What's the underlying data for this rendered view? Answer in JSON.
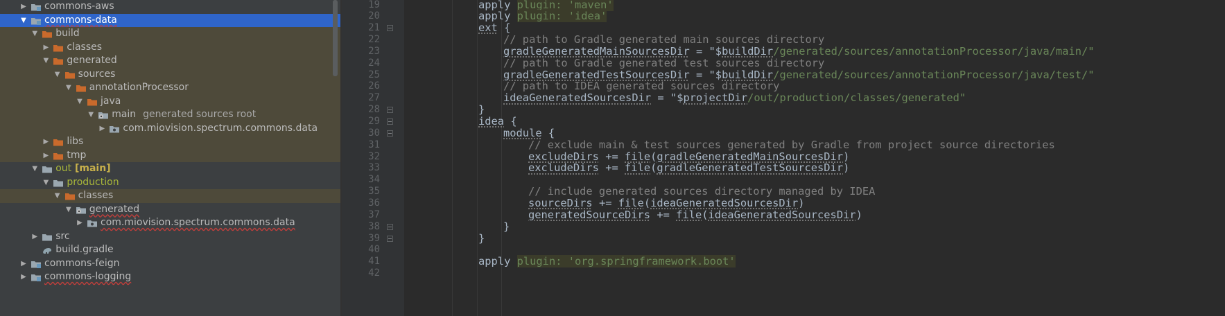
{
  "project_tree": {
    "items": [
      {
        "label": "commons-aws",
        "depth": 0,
        "expanded": false,
        "icon": "module-folder-icon",
        "state": "normal"
      },
      {
        "label": "commons-data",
        "depth": 0,
        "expanded": true,
        "icon": "module-folder-icon",
        "state": "selected",
        "underline": true
      },
      {
        "label": "build",
        "depth": 1,
        "expanded": true,
        "icon": "excluded-folder-icon",
        "state": "excluded"
      },
      {
        "label": "classes",
        "depth": 2,
        "expanded": false,
        "icon": "excluded-folder-icon",
        "state": "excluded"
      },
      {
        "label": "generated",
        "depth": 2,
        "expanded": true,
        "icon": "excluded-folder-icon",
        "state": "excluded"
      },
      {
        "label": "sources",
        "depth": 3,
        "expanded": true,
        "icon": "excluded-folder-icon",
        "state": "excluded"
      },
      {
        "label": "annotationProcessor",
        "depth": 4,
        "expanded": true,
        "icon": "excluded-folder-icon",
        "state": "excluded"
      },
      {
        "label": "java",
        "depth": 5,
        "expanded": true,
        "icon": "excluded-folder-icon",
        "state": "excluded"
      },
      {
        "label": "main",
        "hint": "generated sources root",
        "depth": 6,
        "expanded": true,
        "icon": "generated-source-root-icon",
        "state": "excluded"
      },
      {
        "label": "com.miovision.spectrum.commons.data",
        "depth": 7,
        "expanded": false,
        "icon": "package-icon",
        "state": "excluded"
      },
      {
        "label": "libs",
        "depth": 2,
        "expanded": false,
        "icon": "excluded-folder-icon",
        "state": "excluded"
      },
      {
        "label": "tmp",
        "depth": 2,
        "expanded": false,
        "icon": "excluded-folder-icon",
        "state": "excluded"
      },
      {
        "label": "out",
        "mark": "[main]",
        "depth": 1,
        "expanded": true,
        "icon": "output-folder-icon",
        "state": "normal",
        "olive": true
      },
      {
        "label": "production",
        "depth": 2,
        "expanded": true,
        "icon": "folder-icon",
        "state": "normal",
        "olive": true
      },
      {
        "label": "classes",
        "depth": 3,
        "expanded": true,
        "icon": "excluded-folder-icon",
        "state": "excluded"
      },
      {
        "label": "generated",
        "depth": 4,
        "expanded": true,
        "icon": "generated-source-root-icon",
        "state": "normal",
        "underline": true
      },
      {
        "label": "com.miovision.spectrum.commons.data",
        "depth": 5,
        "expanded": false,
        "icon": "package-icon",
        "state": "normal",
        "underline": true
      },
      {
        "label": "src",
        "depth": 1,
        "expanded": false,
        "icon": "folder-icon",
        "state": "normal"
      },
      {
        "label": "build.gradle",
        "depth": 1,
        "expanded": null,
        "icon": "gradle-file-icon",
        "state": "normal"
      },
      {
        "label": "commons-feign",
        "depth": 0,
        "expanded": false,
        "icon": "module-folder-icon",
        "state": "normal"
      },
      {
        "label": "commons-logging",
        "depth": 0,
        "expanded": false,
        "icon": "module-folder-icon",
        "state": "normal",
        "underline": true
      }
    ]
  },
  "editor": {
    "lines": [
      {
        "n": "19",
        "indent": 0,
        "tokens": [
          {
            "t": "apply ",
            "k": "plain"
          },
          {
            "t": "plugin: 'maven'",
            "k": "hlstr"
          }
        ]
      },
      {
        "n": "20",
        "indent": 0,
        "tokens": [
          {
            "t": "apply ",
            "k": "plain"
          },
          {
            "t": "plugin: 'idea'",
            "k": "hlstr"
          }
        ]
      },
      {
        "n": "21",
        "indent": 0,
        "fold": true,
        "tokens": [
          {
            "t": "ext",
            "k": "var"
          },
          {
            "t": " {",
            "k": "plain"
          }
        ]
      },
      {
        "n": "22",
        "indent": 1,
        "tokens": [
          {
            "t": "// path to Gradle generated main sources directory",
            "k": "com"
          }
        ]
      },
      {
        "n": "23",
        "indent": 1,
        "tokens": [
          {
            "t": "gradleGeneratedMainSourcesDir",
            "k": "var"
          },
          {
            "t": " = \"$",
            "k": "plain"
          },
          {
            "t": "buildDir",
            "k": "var"
          },
          {
            "t": "/generated/sources/annotationProcessor/java/main/\"",
            "k": "str"
          }
        ]
      },
      {
        "n": "24",
        "indent": 1,
        "tokens": [
          {
            "t": "// path to Gradle generated test sources directory",
            "k": "com"
          }
        ]
      },
      {
        "n": "25",
        "indent": 1,
        "tokens": [
          {
            "t": "gradleGeneratedTestSourcesDir",
            "k": "var"
          },
          {
            "t": " = \"$",
            "k": "plain"
          },
          {
            "t": "buildDir",
            "k": "var"
          },
          {
            "t": "/generated/sources/annotationProcessor/java/test/\"",
            "k": "str"
          }
        ]
      },
      {
        "n": "26",
        "indent": 1,
        "tokens": [
          {
            "t": "// path to IDEA generated sources directory",
            "k": "com"
          }
        ]
      },
      {
        "n": "27",
        "indent": 1,
        "tokens": [
          {
            "t": "ideaGeneratedSourcesDir",
            "k": "var"
          },
          {
            "t": " = \"$",
            "k": "plain"
          },
          {
            "t": "projectDir",
            "k": "var"
          },
          {
            "t": "/out/production/classes/generated\"",
            "k": "str"
          }
        ]
      },
      {
        "n": "28",
        "indent": 0,
        "fold": true,
        "tokens": [
          {
            "t": "}",
            "k": "plain"
          }
        ]
      },
      {
        "n": "29",
        "indent": 0,
        "fold": true,
        "tokens": [
          {
            "t": "idea",
            "k": "var"
          },
          {
            "t": " {",
            "k": "plain"
          }
        ]
      },
      {
        "n": "30",
        "indent": 1,
        "fold": true,
        "tokens": [
          {
            "t": "module",
            "k": "var"
          },
          {
            "t": " {",
            "k": "plain"
          }
        ]
      },
      {
        "n": "31",
        "indent": 2,
        "tokens": [
          {
            "t": "// exclude main & test sources generated by Gradle from project source directories",
            "k": "com"
          }
        ]
      },
      {
        "n": "32",
        "indent": 2,
        "tokens": [
          {
            "t": "excludeDirs",
            "k": "var"
          },
          {
            "t": " += ",
            "k": "plain"
          },
          {
            "t": "file",
            "k": "var"
          },
          {
            "t": "(",
            "k": "plain"
          },
          {
            "t": "gradleGeneratedMainSourcesDir",
            "k": "var"
          },
          {
            "t": ")",
            "k": "plain"
          }
        ]
      },
      {
        "n": "33",
        "indent": 2,
        "tokens": [
          {
            "t": "excludeDirs",
            "k": "var"
          },
          {
            "t": " += ",
            "k": "plain"
          },
          {
            "t": "file",
            "k": "var"
          },
          {
            "t": "(",
            "k": "plain"
          },
          {
            "t": "gradleGeneratedTestSourcesDir",
            "k": "var"
          },
          {
            "t": ")",
            "k": "plain"
          }
        ]
      },
      {
        "n": "34",
        "indent": 0,
        "tokens": []
      },
      {
        "n": "35",
        "indent": 2,
        "tokens": [
          {
            "t": "// include generated sources directory managed by IDEA",
            "k": "com"
          }
        ]
      },
      {
        "n": "36",
        "indent": 2,
        "tokens": [
          {
            "t": "sourceDirs",
            "k": "var"
          },
          {
            "t": " += ",
            "k": "plain"
          },
          {
            "t": "file",
            "k": "var"
          },
          {
            "t": "(",
            "k": "plain"
          },
          {
            "t": "ideaGeneratedSourcesDir",
            "k": "var"
          },
          {
            "t": ")",
            "k": "plain"
          }
        ]
      },
      {
        "n": "37",
        "indent": 2,
        "tokens": [
          {
            "t": "generatedSourceDirs",
            "k": "var"
          },
          {
            "t": " += ",
            "k": "plain"
          },
          {
            "t": "file",
            "k": "var"
          },
          {
            "t": "(",
            "k": "plain"
          },
          {
            "t": "ideaGeneratedSourcesDir",
            "k": "var"
          },
          {
            "t": ")",
            "k": "plain"
          }
        ]
      },
      {
        "n": "38",
        "indent": 1,
        "fold": true,
        "tokens": [
          {
            "t": "}",
            "k": "plain"
          }
        ]
      },
      {
        "n": "39",
        "indent": 0,
        "fold": true,
        "tokens": [
          {
            "t": "}",
            "k": "plain"
          }
        ]
      },
      {
        "n": "40",
        "indent": 0,
        "tokens": []
      },
      {
        "n": "41",
        "indent": 0,
        "tokens": [
          {
            "t": "apply ",
            "k": "plain"
          },
          {
            "t": "plugin: 'org.springframework.boot'",
            "k": "hlstr"
          }
        ]
      },
      {
        "n": "42",
        "indent": 0,
        "tokens": []
      }
    ]
  },
  "colors": {
    "selection": "#2f65ca",
    "excluded_row": "#4e4a3a",
    "string": "#6a8759",
    "comment": "#808080",
    "folder_orange": "#c96a2c",
    "module_blue": "#6897bb"
  }
}
